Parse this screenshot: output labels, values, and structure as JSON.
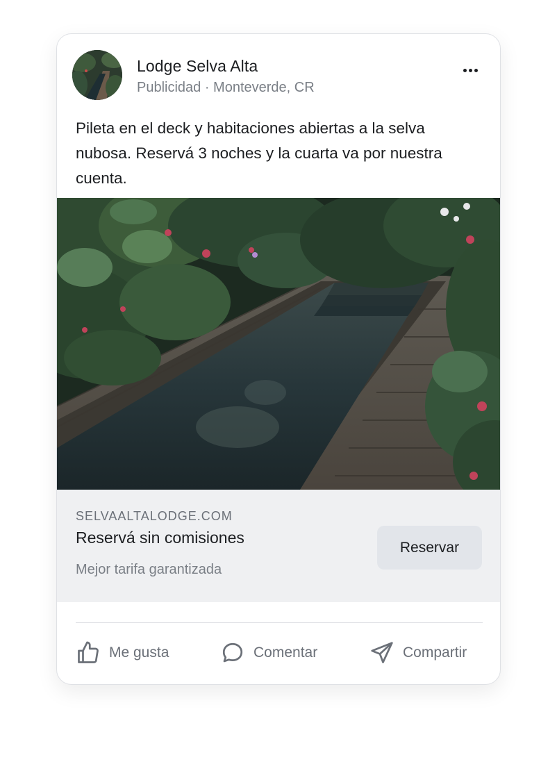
{
  "post": {
    "page_name": "Lodge Selva Alta",
    "meta": "Publicidad · Monteverde, CR",
    "caption": "Pileta en el deck y habitaciones abiertas a la selva nubosa. Reservá 3 noches y la cuarta va por nuestra cuenta.",
    "more_icon": "more-horizontal-icon"
  },
  "link_preview": {
    "domain": "SELVAALTALODGE.COM",
    "headline": "Reservá sin comisiones",
    "subline": "Mejor tarifa garantizada",
    "cta_label": "Reservar"
  },
  "actions": {
    "like_label": "Me gusta",
    "comment_label": "Comentar",
    "share_label": "Compartir"
  },
  "colors": {
    "text_primary": "#1c1e21",
    "text_secondary": "#7a7f86",
    "link_box_bg": "#eff0f2",
    "cta_bg": "#e2e5ea"
  }
}
